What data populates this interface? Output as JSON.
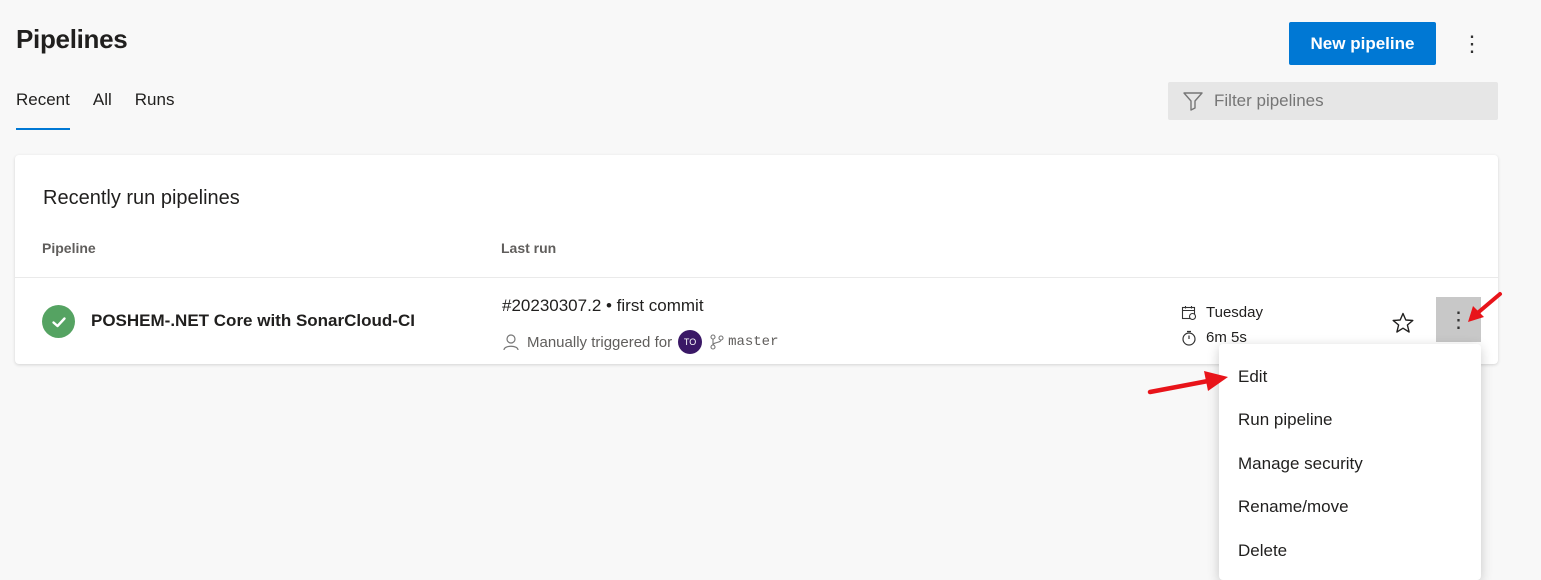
{
  "header": {
    "title": "Pipelines",
    "new_pipeline_label": "New pipeline",
    "more_icon": "more-vertical-icon"
  },
  "tabs": [
    {
      "label": "Recent",
      "active": true
    },
    {
      "label": "All",
      "active": false
    },
    {
      "label": "Runs",
      "active": false
    }
  ],
  "filter": {
    "placeholder": "Filter pipelines",
    "icon": "filter-icon"
  },
  "card": {
    "title": "Recently run pipelines",
    "columns": [
      "Pipeline",
      "Last run"
    ],
    "row": {
      "status": "succeeded",
      "status_color": "#55a362",
      "name": "POSHEM-.NET Core with SonarCloud-CI",
      "run_title": "#20230307.2 • first commit",
      "trigger_text": "Manually triggered for",
      "avatar_initials": "TO",
      "branch": "master",
      "date": "Tuesday",
      "duration": "6m 5s"
    }
  },
  "context_menu": {
    "items": [
      "Edit",
      "Run pipeline",
      "Manage security",
      "Rename/move",
      "Delete"
    ]
  },
  "colors": {
    "accent": "#0078d4",
    "annotation_arrow": "#e8141a"
  }
}
